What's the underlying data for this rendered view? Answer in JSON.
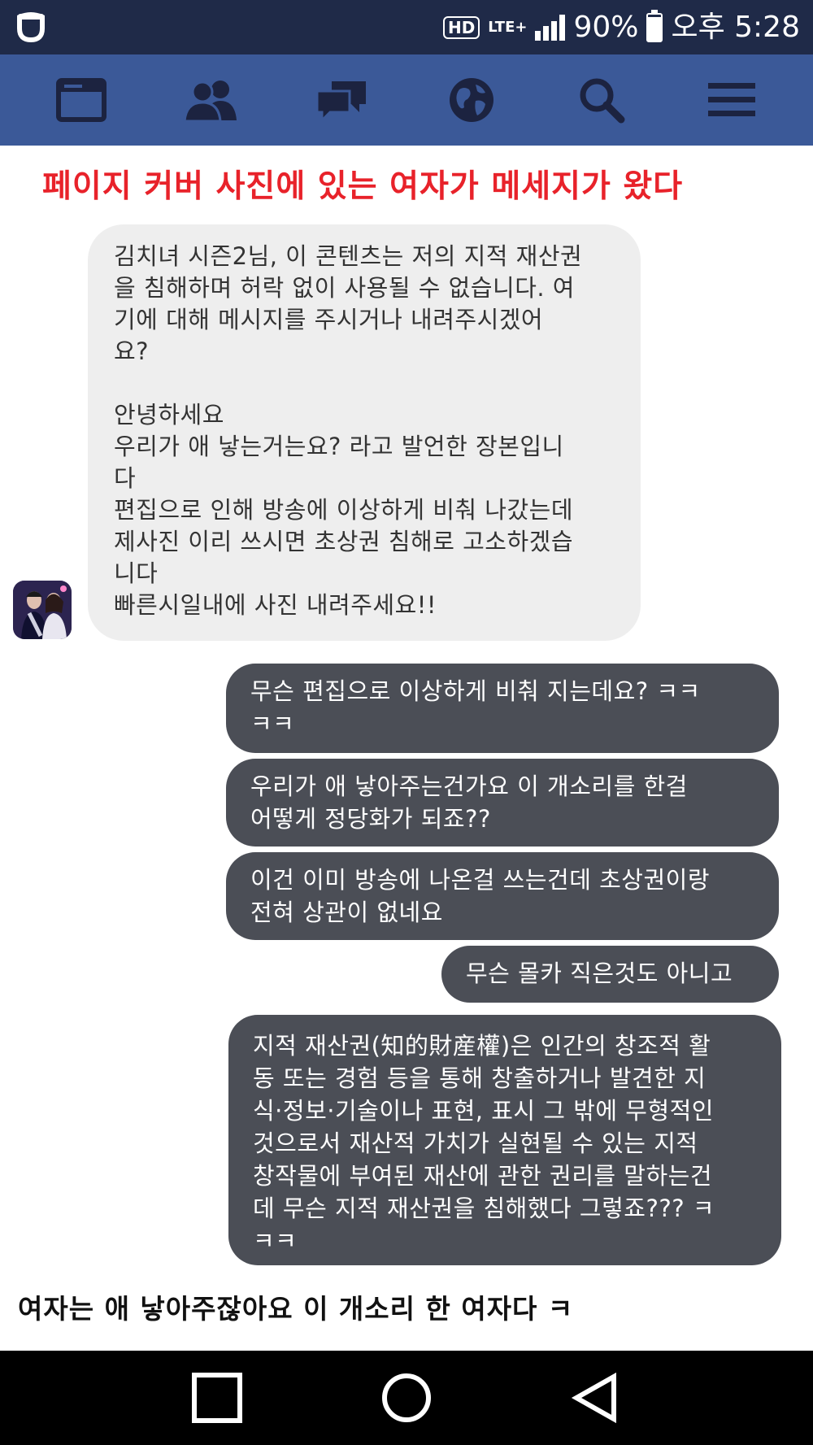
{
  "status_bar": {
    "hd_label": "HD",
    "network_label": "LTE+",
    "battery_text": "90%",
    "battery_level": 0.9,
    "time_text": "오후 5:28",
    "icons": [
      "app-logo-icon",
      "hd-voice-icon",
      "lte-icon",
      "signal-icon",
      "battery-icon"
    ]
  },
  "nav": {
    "background_color": "#3b5998",
    "items": [
      {
        "icon": "news-feed-icon"
      },
      {
        "icon": "friends-icon"
      },
      {
        "icon": "messages-icon"
      },
      {
        "icon": "notifications-globe-icon"
      },
      {
        "icon": "search-icon"
      },
      {
        "icon": "menu-icon"
      }
    ]
  },
  "heading": {
    "text": "페이지 커버 사진에 있는 여자가 메세지가 왔다",
    "color": "#e8222a"
  },
  "messages": [
    {
      "direction": "incoming",
      "text": "김치녀 시즌2님, 이 콘텐츠는 저의 지적 재산권\n을 침해하며 허락 없이 사용될 수 없습니다. 여\n기에 대해 메시지를 주시거나 내려주시겠어\n요?\n\n안녕하세요\n우리가 애 낳는거는요? 라고 발언한 장본입니\n다\n편집으로 인해 방송에 이상하게 비춰 나갔는데\n제사진 이리 쓰시면 초상권 침해로 고소하겠습\n니다\n빠른시일내에 사진 내려주세요!!"
    },
    {
      "direction": "outgoing",
      "text": "무슨 편집으로 이상하게 비춰 지는데요? ㅋㅋ\nㅋㅋ"
    },
    {
      "direction": "outgoing",
      "text": "우리가 애 낳아주는건가요 이 개소리를 한걸\n어떻게 정당화가 되죠??"
    },
    {
      "direction": "outgoing",
      "text": "이건 이미 방송에 나온걸 쓰는건데 초상권이랑\n전혀 상관이 없네요"
    },
    {
      "direction": "outgoing",
      "text": "무슨 몰카 직은것도 아니고"
    },
    {
      "direction": "outgoing",
      "text": "지적 재산권(知的財産權)은 인간의 창조적 활\n동 또는 경험 등을 통해 창출하거나 발견한 지\n식·정보·기술이나 표현, 표시 그 밖에 무형적인\n것으로서 재산적 가치가 실현될 수 있는 지적\n창작물에 부여된 재산에 관한 권리를 말하는건\n데 무슨 지적 재산권을 침해했다 그렇죠??? ㅋ\nㅋㅋ"
    }
  ],
  "footer": {
    "text": "여자는 애 낳아주잖아요 이 개소리 한 여자다 ㅋ"
  },
  "colors": {
    "incoming_bubble": "#eeeeee",
    "outgoing_bubble": "#4b4e56",
    "status_bar": "#1f2a48"
  },
  "android_nav": {
    "items": [
      {
        "icon": "recent-apps-icon"
      },
      {
        "icon": "home-icon"
      },
      {
        "icon": "back-icon"
      }
    ]
  }
}
